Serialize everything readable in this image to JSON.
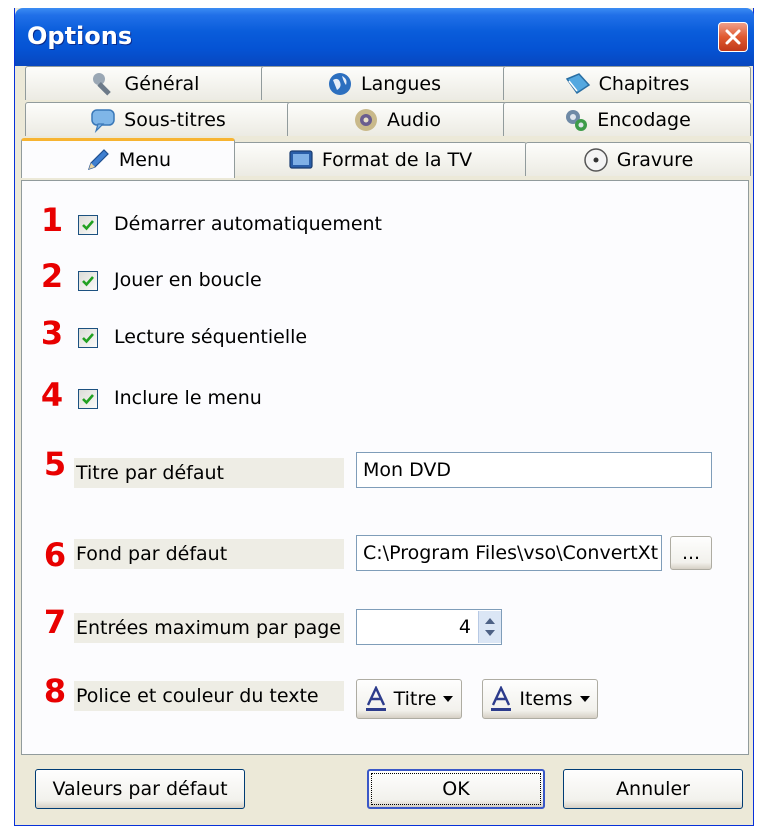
{
  "window": {
    "title": "Options"
  },
  "tabs": {
    "row1": [
      {
        "label": "Général",
        "icon": "wrench-icon"
      },
      {
        "label": "Langues",
        "icon": "globe-icon"
      },
      {
        "label": "Chapitres",
        "icon": "book-icon"
      }
    ],
    "row2": [
      {
        "label": "Sous-titres",
        "icon": "speech-bubble-icon"
      },
      {
        "label": "Audio",
        "icon": "speaker-icon"
      },
      {
        "label": "Encodage",
        "icon": "gears-icon"
      }
    ],
    "row3": [
      {
        "label": "Menu",
        "icon": "pencil-icon",
        "active": true
      },
      {
        "label": "Format de la TV",
        "icon": "tv-icon"
      },
      {
        "label": "Gravure",
        "icon": "disc-icon"
      }
    ]
  },
  "options": {
    "autostart": {
      "number": "1",
      "label": "Démarrer automatiquement",
      "checked": true
    },
    "loop": {
      "number": "2",
      "label": "Jouer en boucle",
      "checked": true
    },
    "sequential": {
      "number": "3",
      "label": "Lecture séquentielle",
      "checked": true
    },
    "include_menu": {
      "number": "4",
      "label": "Inclure le menu",
      "checked": true
    }
  },
  "fields": {
    "title": {
      "number": "5",
      "label": "Titre par défaut",
      "value": "Mon DVD"
    },
    "background": {
      "number": "6",
      "label": "Fond par défaut",
      "value": "C:\\Program Files\\vso\\ConvertXt",
      "browse_label": "..."
    },
    "max_entries": {
      "number": "7",
      "label": "Entrées maximum par page",
      "value": "4"
    },
    "font": {
      "number": "8",
      "label": "Police et couleur du texte",
      "title_button": "Titre",
      "items_button": "Items"
    }
  },
  "buttons": {
    "defaults": "Valeurs par défaut",
    "ok": "OK",
    "cancel": "Annuler"
  },
  "colors": {
    "titlebar": "#0553d4",
    "annotation_numbers": "#e80000",
    "active_tab_accent": "#f7b431",
    "checkmark": "#21a121"
  }
}
